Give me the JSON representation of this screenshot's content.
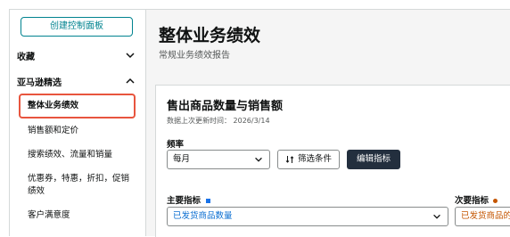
{
  "sidebar": {
    "create_button": "创建控制面板",
    "favorites_label": "收藏",
    "amazon_selection_label": "亚马逊精选",
    "items": [
      {
        "label": "整体业务绩效"
      },
      {
        "label": "销售额和定价"
      },
      {
        "label": "搜索绩效、流量和销量"
      },
      {
        "label": "优惠券，特惠，折扣，促销绩效"
      },
      {
        "label": "客户满意度"
      }
    ]
  },
  "main": {
    "title": "整体业务绩效",
    "subtitle": "常规业务绩效报告"
  },
  "card": {
    "title": "售出商品数量与销售额",
    "updated": "数据上次更新时间： 2026/3/14",
    "frequency_label": "频率",
    "frequency_value": "每月",
    "filter_button": "筛选条件",
    "edit_button": "编辑指标",
    "primary_metric_label": "主要指标",
    "primary_metric_value": "已发货商品数量",
    "secondary_metric_label": "次要指标",
    "secondary_metric_value": "已发货商品的"
  },
  "colors": {
    "accent": "#00838f",
    "highlight": "#e8553e",
    "primary_dot": "#1a73e8",
    "secondary_label": "#c45500",
    "dark_button": "#232f3e"
  }
}
